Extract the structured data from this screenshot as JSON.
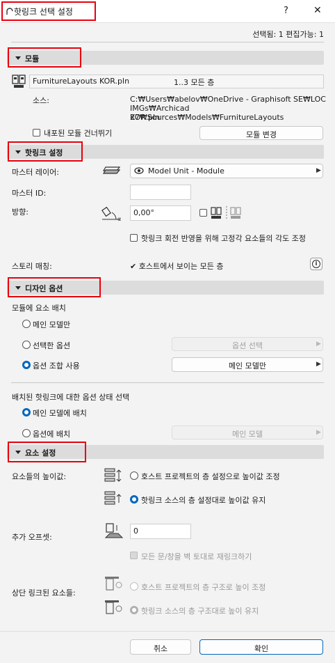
{
  "window": {
    "title": "핫링크 선택 설정",
    "help_label": "?",
    "close_label": "✕"
  },
  "status": "선택됨: 1 편집가능: 1",
  "sections": {
    "module": "모듈",
    "hotlink": "핫링크 설정",
    "design": "디자인 옵션",
    "element": "요소 설정"
  },
  "module": {
    "file_name": "FurnitureLayouts KOR.pln",
    "stories": "1..3 모든 층",
    "source_label": "소스:",
    "source_path_1": "C:₩Users₩abelov₩OneDrive - Graphisoft SE₩LOC",
    "source_path_2": "IMGs₩Archicad 27₩Sources₩Models₩FurnitureLayouts",
    "source_path_3": "KOR.pln",
    "skip_nested_label": "내포된 모듈 건너뛰기",
    "change_module_label": "모듈 변경"
  },
  "hotlink": {
    "master_layer_label": "마스터 레이어:",
    "master_layer_value": "Model Unit - Module",
    "master_id_label": "마스터 ID:",
    "master_id_value": "",
    "orientation_label": "방향:",
    "angle_value": "0,00°",
    "adjust_angle_label": "핫링크 회전 반영을 위해 고정각 요소들의 각도 조정",
    "story_match_label": "스토리 매칭:",
    "story_match_value": "✔ 호스트에서 보이는 모든 층",
    "info_label": "i"
  },
  "design": {
    "place_label": "모듈에 요소 배치",
    "main_model_only": "메인 모델만",
    "selected_option": "선택한 옵션",
    "option_select_btn": "옵션 선택",
    "use_combo": "옵션 조합 사용",
    "main_model_btn": "메인 모델만",
    "state_label": "배치된 핫링크에 대한 옵션 상태 선택",
    "place_main": "메인 모델에 배치",
    "place_option": "옵션에 배치",
    "main_model_disabled_btn": "메인 모델"
  },
  "element": {
    "height_label": "요소들의 높이값:",
    "height_opt1": "호스트 프로젝트의 층 설정으로 높이값 조정",
    "height_opt2": "핫링크 소스의 층 설정대로 높이값 유지",
    "offset_label": "추가 오프셋:",
    "offset_value": "0",
    "relink_label": "모든 문/창을 벽 토대로 재링크하기",
    "top_linked_label": "상단 링크된 요소들:",
    "top_opt1": "호스트 프로젝트의 층 구조로 높이 조정",
    "top_opt2": "핫링크 소스의 층 구조대로 높이 유지"
  },
  "footer": {
    "cancel": "취소",
    "ok": "확인"
  }
}
